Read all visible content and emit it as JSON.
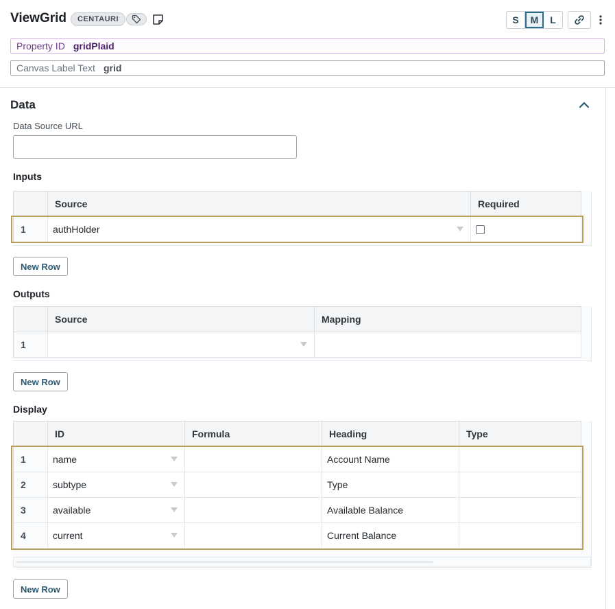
{
  "header": {
    "title": "ViewGrid",
    "badge": "CENTAURI",
    "sizes": [
      "S",
      "M",
      "L"
    ],
    "active_size": "M"
  },
  "property": {
    "label": "Property ID",
    "value": "gridPlaid"
  },
  "canvas_label": {
    "label": "Canvas Label Text",
    "value": "grid"
  },
  "data_section": {
    "title": "Data",
    "data_source_label": "Data Source URL",
    "data_source_value": ""
  },
  "inputs": {
    "title": "Inputs",
    "headers": [
      "Source",
      "Required"
    ],
    "rows": [
      {
        "num": "1",
        "source": "authHolder",
        "required": false
      }
    ],
    "new_row": "New Row"
  },
  "outputs": {
    "title": "Outputs",
    "headers": [
      "Source",
      "Mapping"
    ],
    "rows": [
      {
        "num": "1",
        "source": "",
        "mapping": ""
      }
    ],
    "new_row": "New Row"
  },
  "display": {
    "title": "Display",
    "headers": [
      "ID",
      "Formula",
      "Heading",
      "Type"
    ],
    "rows": [
      {
        "num": "1",
        "id": "name",
        "formula": "",
        "heading": "Account Name",
        "type": ""
      },
      {
        "num": "2",
        "id": "subtype",
        "formula": "",
        "heading": "Type",
        "type": ""
      },
      {
        "num": "3",
        "id": "available",
        "formula": "",
        "heading": "Available Balance",
        "type": ""
      },
      {
        "num": "4",
        "id": "current",
        "formula": "",
        "heading": "Current Balance",
        "type": ""
      }
    ],
    "new_row": "New Row"
  },
  "colors": {
    "property_border": "#d6b3e6",
    "selection_border": "#b8a05a",
    "active_size": "#2d6a8a"
  },
  "icons": [
    "tag-icon",
    "note-icon",
    "link-icon",
    "kebab-menu-icon",
    "chevron-up-icon",
    "dropdown-arrow-icon"
  ]
}
